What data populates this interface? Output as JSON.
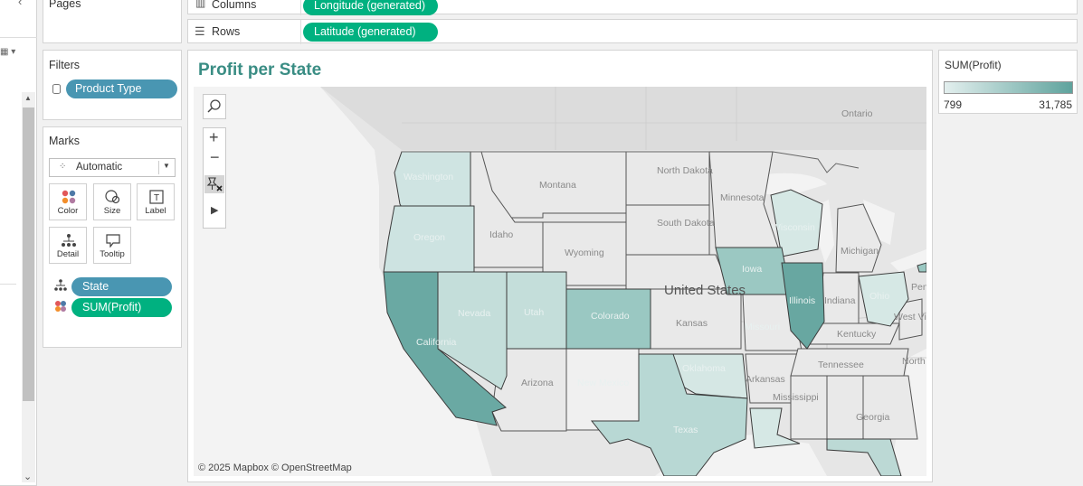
{
  "shelves": {
    "pages_label": "Pages",
    "columns_label": "Columns",
    "columns_pill": "Longitude (generated)",
    "rows_label": "Rows",
    "rows_pill": "Latitude (generated)"
  },
  "filters": {
    "title": "Filters",
    "pill": "Product Type"
  },
  "marks": {
    "title": "Marks",
    "mark_type": "Automatic",
    "buttons": [
      {
        "label": "Color"
      },
      {
        "label": "Size"
      },
      {
        "label": "Label"
      },
      {
        "label": "Detail"
      },
      {
        "label": "Tooltip"
      }
    ],
    "fields": [
      {
        "label": "State"
      },
      {
        "label": "SUM(Profit)"
      }
    ]
  },
  "view": {
    "title": "Profit per State",
    "attribution": "© 2025 Mapbox © OpenStreetMap"
  },
  "legend": {
    "title": "SUM(Profit)",
    "min": "799",
    "max": "31,785",
    "color_low": "#e3efee",
    "color_high": "#5fa39d"
  },
  "map_labels": {
    "ontario": "Ontario",
    "washington": "Washington",
    "montana": "Montana",
    "north_dakota": "North Dakota",
    "minnesota": "Minnesota",
    "oregon": "Oregon",
    "idaho": "Idaho",
    "south_dakota": "South Dakota",
    "wyoming": "Wyoming",
    "wisconsin": "Wisconsin",
    "michigan": "Michigan",
    "iowa": "Iowa",
    "nevada": "Nevada",
    "utah": "Utah",
    "colorado": "Colorado",
    "united_states": "United States",
    "kansas": "Kansas",
    "illinois": "Illinois",
    "indiana": "Indiana",
    "ohio": "Ohio",
    "pennsylvania": "Pen",
    "california": "California",
    "missouri": "Missouri",
    "kentucky": "Kentucky",
    "west_virginia": "West Virginia",
    "oklahoma": "Oklahoma",
    "tennessee": "Tennessee",
    "north_carolina": "North Carolin",
    "arizona": "Arizona",
    "new_mexico": "New Mexico",
    "arkansas": "Arkansas",
    "mississippi": "Mississippi",
    "georgia": "Georgia",
    "texas": "Texas"
  }
}
